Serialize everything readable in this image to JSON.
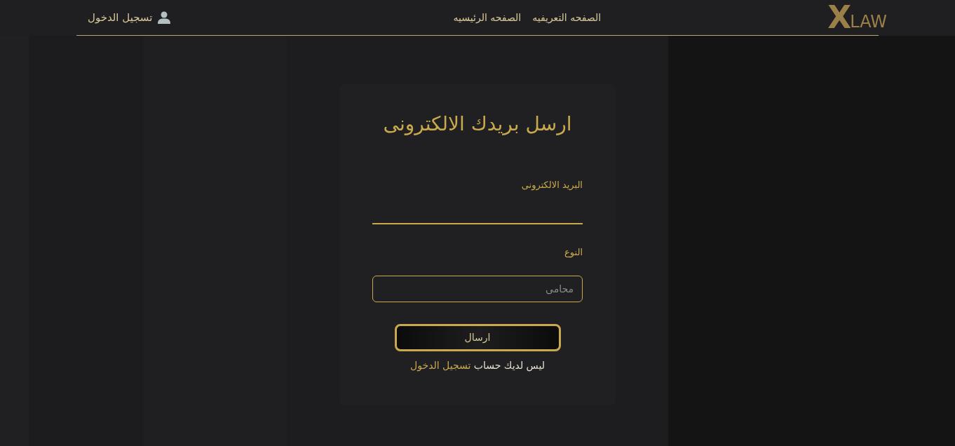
{
  "header": {
    "logo": {
      "mark": "X",
      "text": "LAW"
    },
    "nav": [
      {
        "label": "الصفحه التعريفيه"
      },
      {
        "label": "الصفحه الرئيسيه"
      }
    ],
    "login": {
      "label": "تسجيل الدخول"
    }
  },
  "card": {
    "title": "ارسل بريدك الالكترونى",
    "fields": [
      {
        "kind": "underline",
        "label": "البريد الالكترونى"
      },
      {
        "kind": "box",
        "label": "النوع",
        "placeholder": "محامى"
      }
    ],
    "button": "ارسال",
    "footer": {
      "text": "ليس لديك حساب",
      "link": "تسجيل الدخول"
    }
  }
}
